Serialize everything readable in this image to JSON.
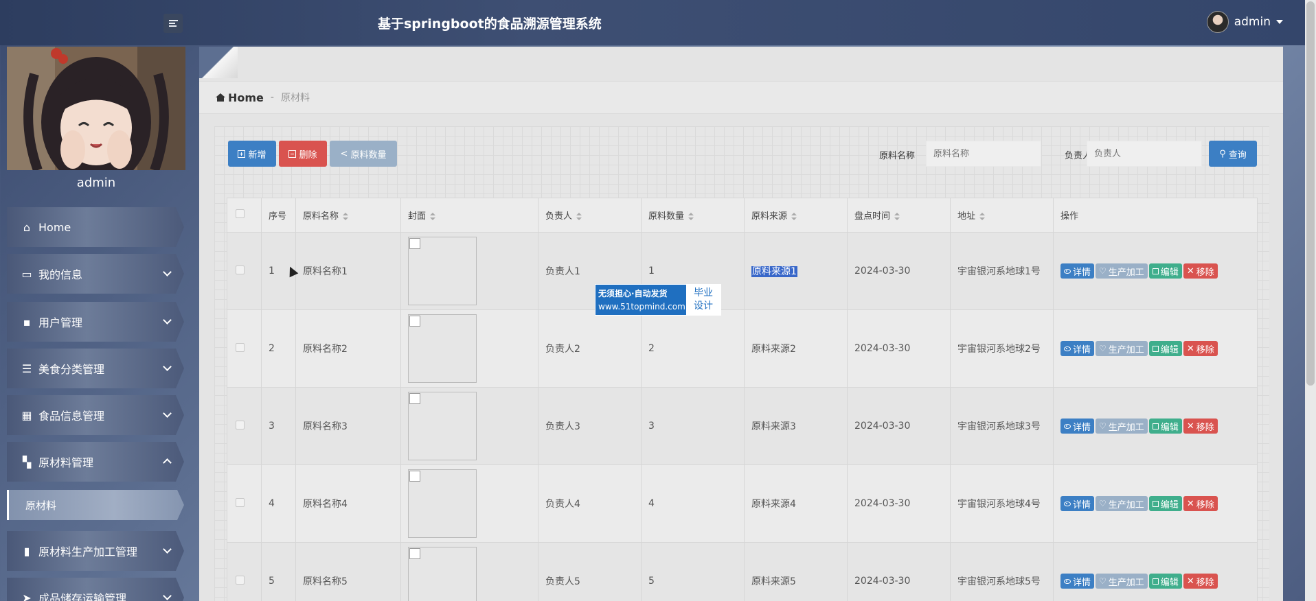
{
  "header": {
    "title": "基于springboot的食品溯源管理系统",
    "username": "admin"
  },
  "sidebar": {
    "profile_name": "admin",
    "items": [
      {
        "label": "Home",
        "icon": "home-icon",
        "expand": "none"
      },
      {
        "label": "我的信息",
        "icon": "card-icon",
        "expand": "down"
      },
      {
        "label": "用户管理",
        "icon": "chat-icon",
        "expand": "down"
      },
      {
        "label": "美食分类管理",
        "icon": "list-icon",
        "expand": "down"
      },
      {
        "label": "食品信息管理",
        "icon": "grid-icon",
        "expand": "down"
      },
      {
        "label": "原材料管理",
        "icon": "tiles-icon",
        "expand": "up"
      },
      {
        "label": "原材料生产加工管理",
        "icon": "book-icon",
        "expand": "down"
      },
      {
        "label": "成品储存运输管理",
        "icon": "send-icon",
        "expand": "down"
      }
    ],
    "sub_item": "原材料"
  },
  "breadcrumb": {
    "home": "Home",
    "separator": "-",
    "current": "原材料"
  },
  "toolbar": {
    "add_label": "新增",
    "delete_label": "删除",
    "qty_label": "原料数量",
    "search_label": "查询",
    "name_label": "原料名称",
    "name_placeholder": "原料名称",
    "person_label": "负责人",
    "person_placeholder": "负责人"
  },
  "table": {
    "headers": [
      "序号",
      "原料名称",
      "封面",
      "负责人",
      "原料数量",
      "原料来源",
      "盘点时间",
      "地址",
      "操作"
    ],
    "rows": [
      {
        "no": "1",
        "name": "原料名称1",
        "person": "负责人1",
        "qty": "1",
        "source": "原料来源1",
        "date": "2024-03-30",
        "addr": "宇宙银河系地球1号"
      },
      {
        "no": "2",
        "name": "原料名称2",
        "person": "负责人2",
        "qty": "2",
        "source": "原料来源2",
        "date": "2024-03-30",
        "addr": "宇宙银河系地球2号"
      },
      {
        "no": "3",
        "name": "原料名称3",
        "person": "负责人3",
        "qty": "3",
        "source": "原料来源3",
        "date": "2024-03-30",
        "addr": "宇宙银河系地球3号"
      },
      {
        "no": "4",
        "name": "原料名称4",
        "person": "负责人4",
        "qty": "4",
        "source": "原料来源4",
        "date": "2024-03-30",
        "addr": "宇宙银河系地球4号"
      },
      {
        "no": "5",
        "name": "原料名称5",
        "person": "负责人5",
        "qty": "5",
        "source": "原料来源5",
        "date": "2024-03-30",
        "addr": "宇宙银河系地球5号"
      }
    ],
    "actions": {
      "detail": "详情",
      "produce": "生产加工",
      "edit": "编辑",
      "remove": "移除"
    }
  },
  "watermark": {
    "line1": "无须担心·自动发货",
    "url": "www.51topmind.com",
    "badge_line1": "毕业",
    "badge_line2": "设计"
  },
  "colors": {
    "primary": "#3c7fc4",
    "danger": "#d9534f",
    "success": "#3fae8c",
    "muted": "#9ab0c7",
    "highlight": "#3867c9"
  }
}
